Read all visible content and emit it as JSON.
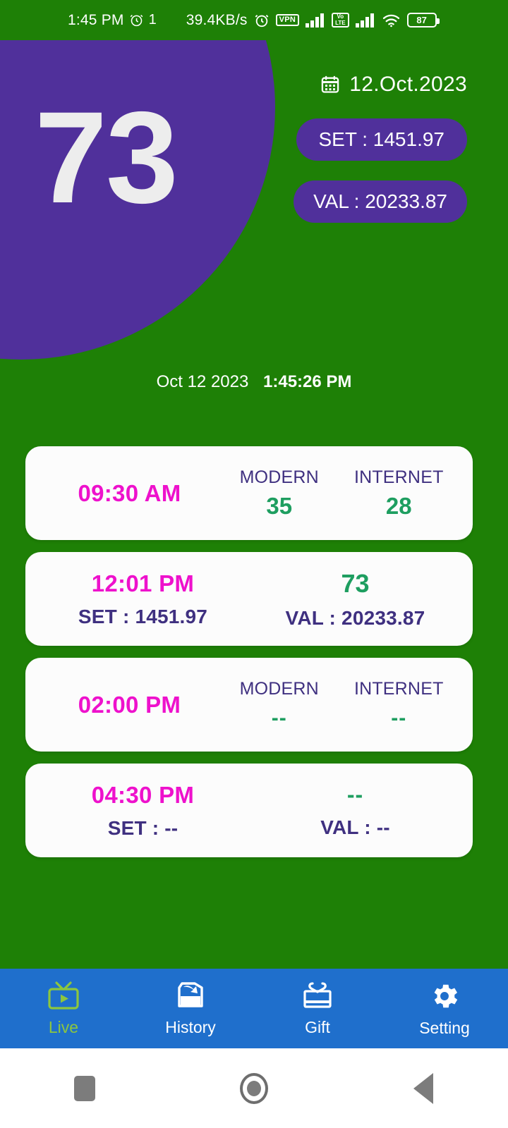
{
  "statusbar": {
    "time": "1:45 PM",
    "alarm_icon": "alarm-clock-icon",
    "one_badge": "1",
    "net_speed": "39.4KB/s",
    "alarm2_icon": "alarm-clock-icon",
    "vpn_label": "VPN",
    "volte_top": "Vo",
    "volte_bottom": "LTE",
    "signal_icon": "signal-bars-icon",
    "wifi_icon": "wifi-icon",
    "battery_level": "87"
  },
  "header": {
    "big_number": "73",
    "calendar_icon": "calendar-icon",
    "date": "12.Oct.2023",
    "set_pill": "SET : 1451.97",
    "val_pill": "VAL : 20233.87"
  },
  "timestamp": {
    "date": "Oct 12 2023",
    "time": "1:45:26 PM"
  },
  "cards": [
    {
      "layout": "A",
      "time": "09:30 AM",
      "left_label": "MODERN",
      "left_value": "35",
      "right_label": "INTERNET",
      "right_value": "28"
    },
    {
      "layout": "B",
      "time": "12:01 PM",
      "big_value": "73",
      "set_text": "SET : 1451.97",
      "val_text": "VAL : 20233.87"
    },
    {
      "layout": "A",
      "time": "02:00 PM",
      "left_label": "MODERN",
      "left_value": "--",
      "right_label": "INTERNET",
      "right_value": "--"
    },
    {
      "layout": "B",
      "time": "04:30 PM",
      "big_value": "--",
      "set_text": "SET : --",
      "val_text": "VAL : --"
    }
  ],
  "bottom_nav": [
    {
      "label": "Live",
      "icon": "tv-live-icon",
      "active": true
    },
    {
      "label": "History",
      "icon": "history-icon",
      "active": false
    },
    {
      "label": "Gift",
      "icon": "gift-icon",
      "active": false
    },
    {
      "label": "Setting",
      "icon": "gear-icon",
      "active": false
    }
  ],
  "android_nav": {
    "recents_icon": "square-recents-icon",
    "home_icon": "circle-home-icon",
    "back_icon": "triangle-back-icon"
  },
  "colors": {
    "background_green": "#1E8006",
    "purple": "#50309B",
    "magenta": "#EE11CC",
    "value_green": "#1E9E60",
    "label_purple": "#3F3080",
    "nav_blue": "#1F6FCC",
    "nav_active": "#8CC63F",
    "card_white": "#FCFCFC"
  }
}
